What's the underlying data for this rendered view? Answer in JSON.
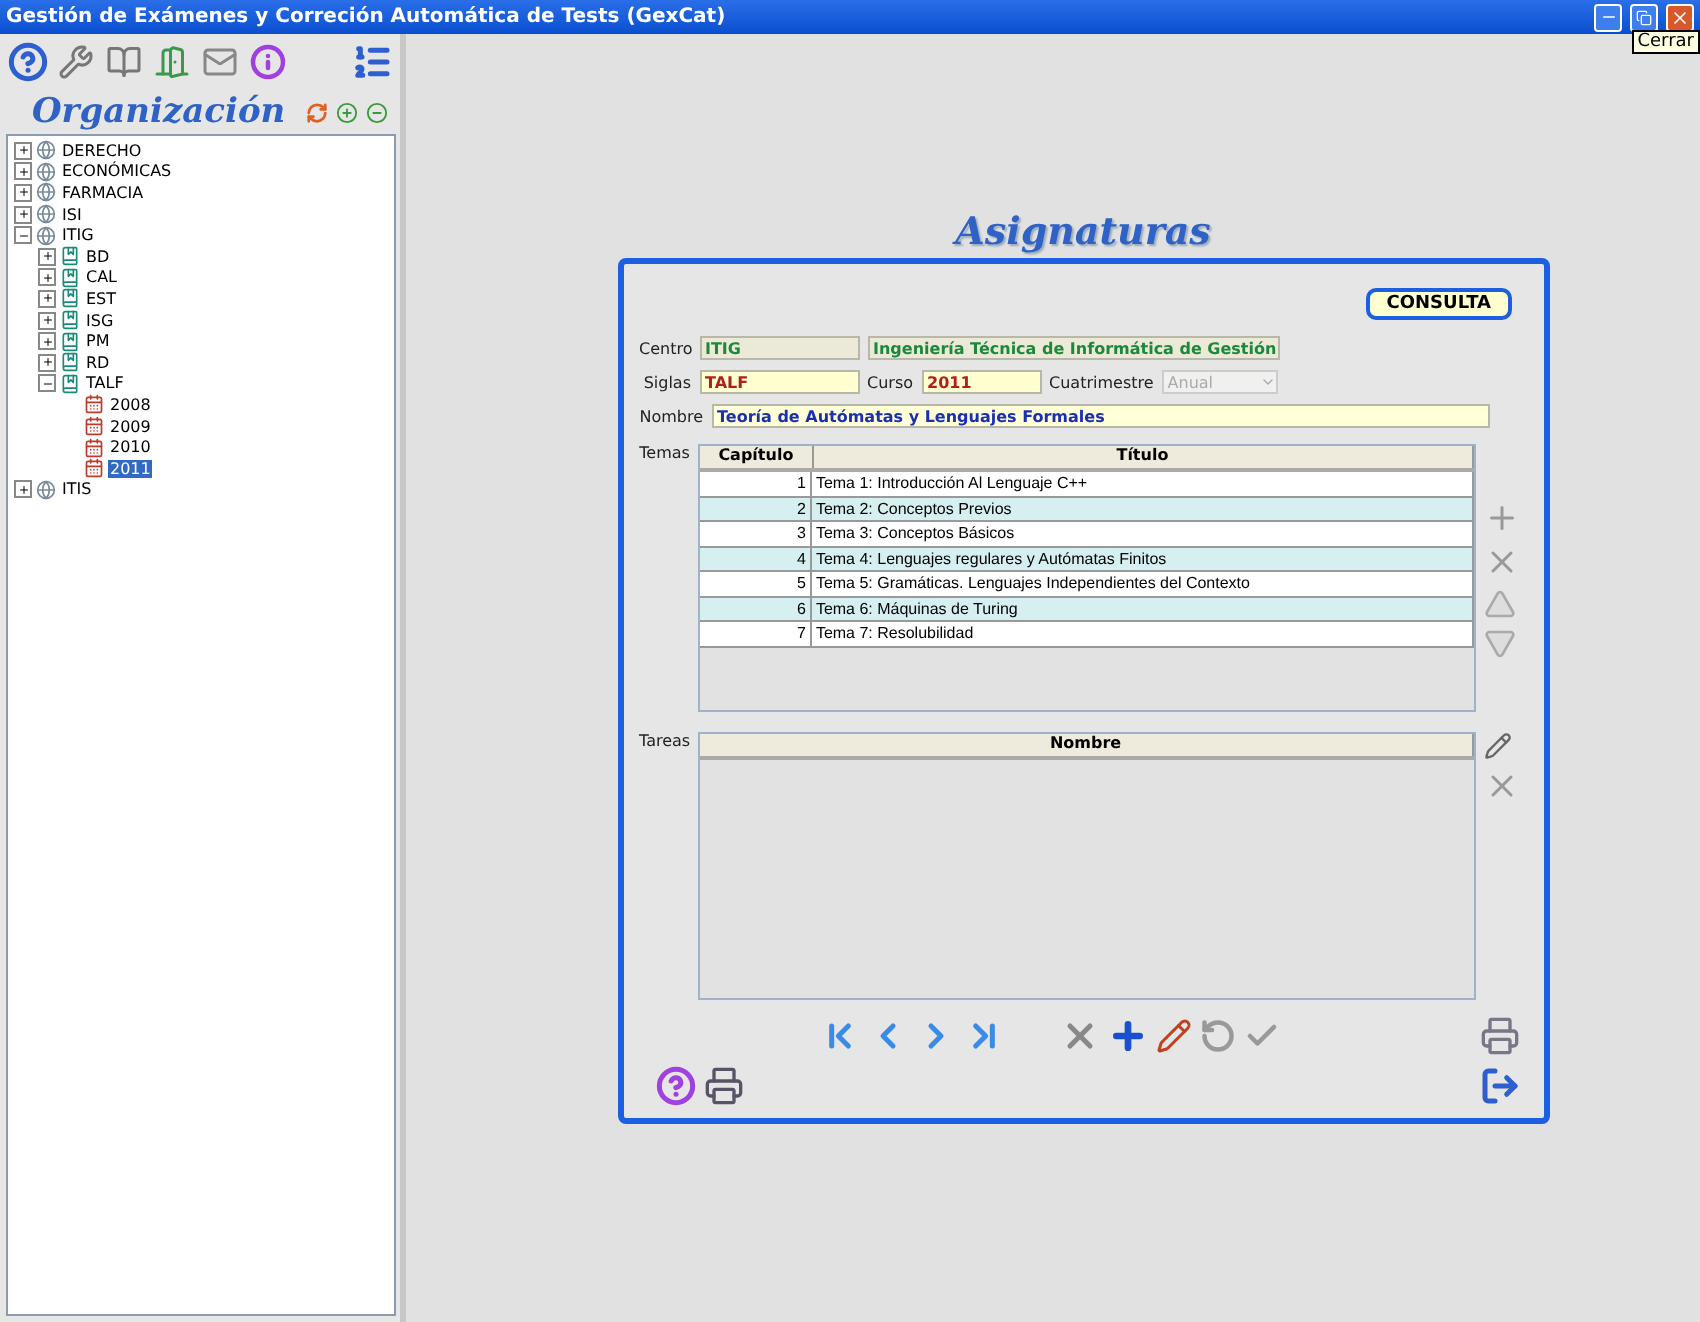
{
  "window": {
    "title": "Gestión de Exámenes y Correción Automática de Tests (GexCat)",
    "tooltip": "Cerrar"
  },
  "sidebar": {
    "title": "Organización",
    "tree": [
      {
        "label": "DERECHO",
        "kind": "center",
        "expanded": false,
        "selected": false
      },
      {
        "label": "ECONÓMICAS",
        "kind": "center",
        "expanded": false,
        "selected": false
      },
      {
        "label": "FARMACIA",
        "kind": "center",
        "expanded": false,
        "selected": false
      },
      {
        "label": "ISI",
        "kind": "center",
        "expanded": false,
        "selected": false
      },
      {
        "label": "ITIG",
        "kind": "center",
        "expanded": true,
        "selected": false,
        "children": [
          {
            "label": "BD",
            "kind": "subject",
            "expanded": false,
            "selected": false
          },
          {
            "label": "CAL",
            "kind": "subject",
            "expanded": false,
            "selected": false
          },
          {
            "label": "EST",
            "kind": "subject",
            "expanded": false,
            "selected": false
          },
          {
            "label": "ISG",
            "kind": "subject",
            "expanded": false,
            "selected": false
          },
          {
            "label": "PM",
            "kind": "subject",
            "expanded": false,
            "selected": false
          },
          {
            "label": "RD",
            "kind": "subject",
            "expanded": false,
            "selected": false
          },
          {
            "label": "TALF",
            "kind": "subject",
            "expanded": true,
            "selected": false,
            "children": [
              {
                "label": "2008",
                "kind": "year",
                "selected": false
              },
              {
                "label": "2009",
                "kind": "year",
                "selected": false
              },
              {
                "label": "2010",
                "kind": "year",
                "selected": false
              },
              {
                "label": "2011",
                "kind": "year",
                "selected": true
              }
            ]
          }
        ]
      },
      {
        "label": "ITIS",
        "kind": "center",
        "expanded": false,
        "selected": false
      }
    ]
  },
  "form": {
    "title": "Asignaturas",
    "consulta": "CONSULTA",
    "centro": {
      "label": "Centro",
      "code": "ITIG",
      "name": "Ingeniería Técnica de Informática de Gestión"
    },
    "siglas": {
      "label": "Siglas",
      "value": "TALF"
    },
    "curso": {
      "label": "Curso",
      "value": "2011"
    },
    "cuatrimestre": {
      "label": "Cuatrimestre",
      "value": "Anual",
      "disabled": true
    },
    "nombre": {
      "label": "Nombre",
      "value": "Teoría de Autómatas y Lenguajes Formales"
    },
    "temas": {
      "label": "Temas",
      "columns": [
        "Capítulo",
        "Título"
      ],
      "rows": [
        {
          "capitulo": "1",
          "titulo": "Tema 1: Introducción Al Lenguaje C++"
        },
        {
          "capitulo": "2",
          "titulo": "Tema 2: Conceptos Previos"
        },
        {
          "capitulo": "3",
          "titulo": "Tema 3: Conceptos Básicos"
        },
        {
          "capitulo": "4",
          "titulo": "Tema 4: Lenguajes regulares y Autómatas Finitos"
        },
        {
          "capitulo": "5",
          "titulo": "Tema 5: Gramáticas. Lenguajes Independientes del Contexto"
        },
        {
          "capitulo": "6",
          "titulo": "Tema 6: Máquinas de Turing"
        },
        {
          "capitulo": "7",
          "titulo": "Tema 7: Resolubilidad"
        }
      ]
    },
    "tareas": {
      "label": "Tareas",
      "columns": [
        "Nombre"
      ]
    }
  }
}
